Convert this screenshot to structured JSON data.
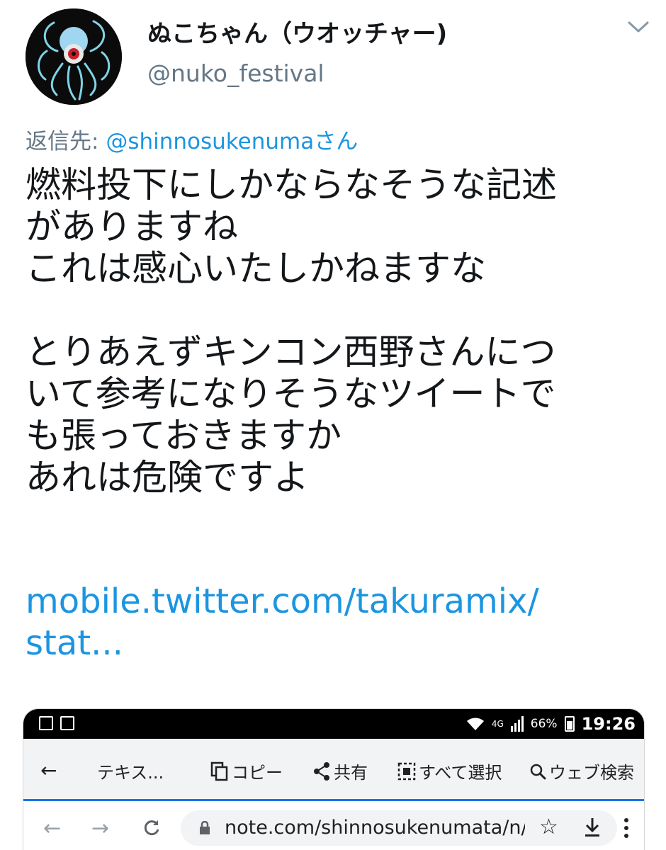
{
  "tweet": {
    "display_name": "ぬこちゃん（ウオッチャー)",
    "handle": "@nuko_festival",
    "reply_prefix": "返信先:",
    "reply_to": "@shinnosukenumaさん",
    "body_lines": [
      "燃料投下にしかならなそうな記述",
      "がありますね",
      "これは感心いたしかねますな",
      "",
      "とりあえずキンコン西野さんにつ",
      "いて参考になりそうなツイートで",
      "も張っておきますか",
      "あれは危険ですよ"
    ],
    "link_lines": [
      "mobile.twitter.com/takuramix/",
      "stat..."
    ],
    "icons": {
      "avatar": "octopus-avatar",
      "menu": "chevron-down-icon"
    },
    "colors": {
      "link": "#1b95e0",
      "muted": "#657786",
      "text": "#14171a"
    }
  },
  "embed": {
    "status_bar": {
      "network": "4G",
      "battery": "66%",
      "time": "19:26"
    },
    "selection_toolbar": {
      "back": "←",
      "text_label": "テキス...",
      "copy": "コピー",
      "share": "共有",
      "select_all": "すべて選択",
      "web_search": "ウェブ検索"
    },
    "browser": {
      "back": "←",
      "forward": "→",
      "reload": "C",
      "url": "note.com/shinnosukenumata/n/n(",
      "star": "☆"
    }
  }
}
